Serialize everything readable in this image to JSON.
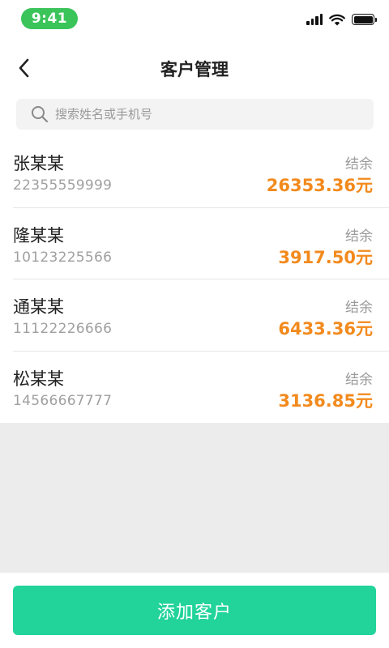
{
  "status_bar": {
    "time": "9:41",
    "icons": [
      "signal-icon",
      "wifi-icon",
      "battery-icon"
    ]
  },
  "nav": {
    "title": "客户管理",
    "back_icon": "chevron-left-icon"
  },
  "search": {
    "placeholder": "搜索姓名或手机号",
    "value": "",
    "icon": "search-icon"
  },
  "customers": [
    {
      "name": "张某某",
      "phone": "22355559999",
      "balance_label": "结余",
      "balance": "26353.36元"
    },
    {
      "name": "隆某某",
      "phone": "10123225566",
      "balance_label": "结余",
      "balance": "3917.50元"
    },
    {
      "name": "通某某",
      "phone": "11122226666",
      "balance_label": "结余",
      "balance": "6433.36元"
    },
    {
      "name": "松某某",
      "phone": "14566667777",
      "balance_label": "结余",
      "balance": "3136.85元"
    }
  ],
  "footer": {
    "add_label": "添加客户"
  },
  "colors": {
    "accent": "#22d39a",
    "amount": "#f28a1d",
    "time_pill": "#3ac45a"
  }
}
